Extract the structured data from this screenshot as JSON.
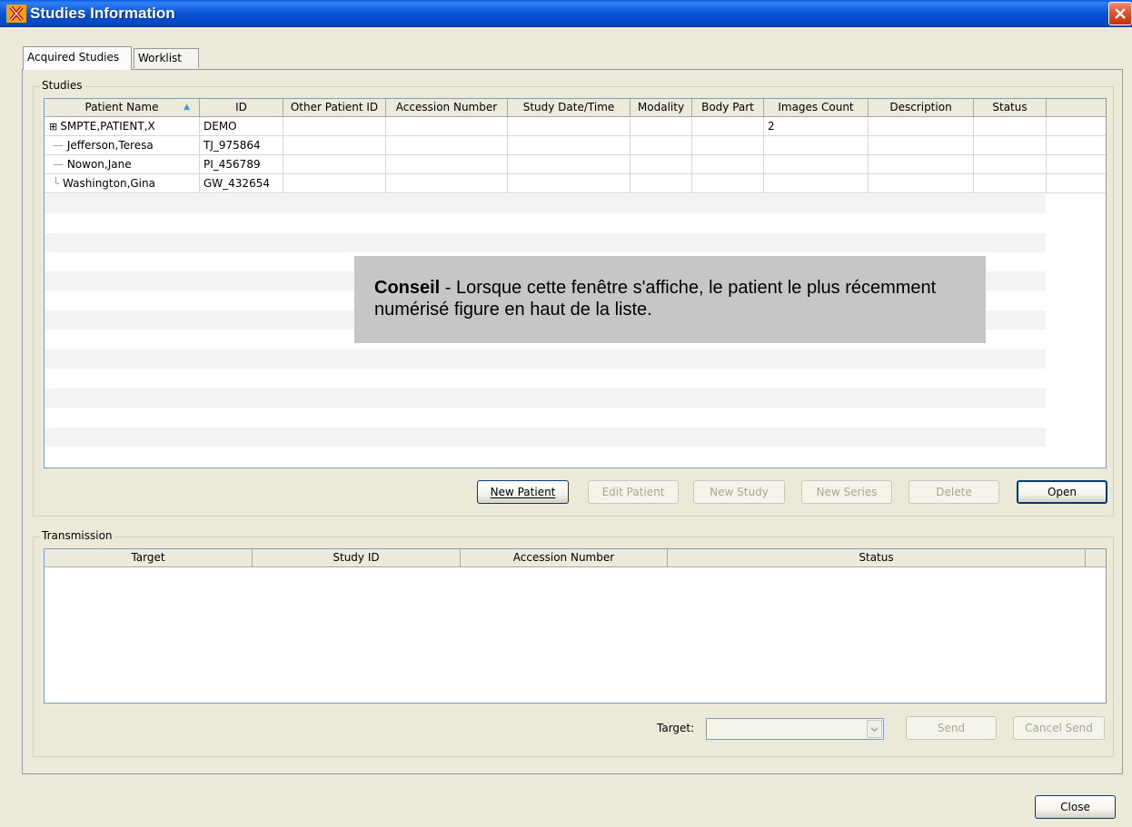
{
  "window": {
    "title": "Studies Information",
    "accent": "#0a5ae0"
  },
  "tabs": [
    {
      "label": "Acquired Studies",
      "selected": true
    },
    {
      "label": "Worklist",
      "selected": false
    }
  ],
  "studies": {
    "group_label": "Studies",
    "columns": [
      "Patient Name",
      "ID",
      "Other Patient ID",
      "Accession Number",
      "Study Date/Time",
      "Modality",
      "Body Part",
      "Images Count",
      "Description",
      "Status"
    ],
    "sort_indicator": "▲",
    "rows": [
      {
        "name": "SMPTE,PATIENT,X",
        "id": "DEMO",
        "other_id": "",
        "accession": "",
        "study_date": "",
        "modality": "",
        "body_part": "",
        "images_count": "2",
        "description": "",
        "status": "",
        "expander": "⊞"
      },
      {
        "name": "Jefferson,Teresa",
        "id": "TJ_975864",
        "other_id": "",
        "accession": "",
        "study_date": "",
        "modality": "",
        "body_part": "",
        "images_count": "",
        "description": "",
        "status": ""
      },
      {
        "name": "Nowon,Jane",
        "id": "PI_456789",
        "other_id": "",
        "accession": "",
        "study_date": "",
        "modality": "",
        "body_part": "",
        "images_count": "",
        "description": "",
        "status": ""
      },
      {
        "name": "Washington,Gina",
        "id": "GW_432654",
        "other_id": "",
        "accession": "",
        "study_date": "",
        "modality": "",
        "body_part": "",
        "images_count": "",
        "description": "",
        "status": ""
      }
    ],
    "buttons": {
      "new_patient": "New Patient",
      "edit_patient": "Edit Patient",
      "new_study": "New Study",
      "new_series": "New Series",
      "delete": "Delete",
      "open": "Open"
    }
  },
  "transmission": {
    "group_label": "Transmission",
    "columns": [
      "Target",
      "Study ID",
      "Accession Number",
      "Status"
    ],
    "target_label": "Target:",
    "target_value": "",
    "buttons": {
      "send": "Send",
      "cancel_send": "Cancel Send"
    }
  },
  "footer": {
    "close": "Close"
  },
  "tip": {
    "bold": "Conseil",
    "text": " - Lorsque cette fenêtre s'affiche, le patient le plus récemment numérisé figure en haut de la liste."
  }
}
